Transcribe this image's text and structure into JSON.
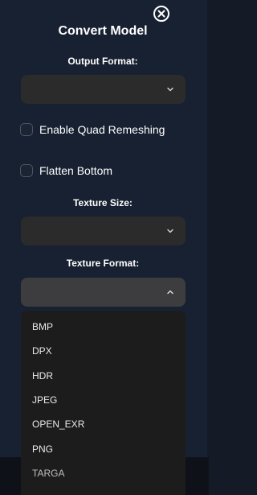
{
  "dialog": {
    "title": "Convert Model",
    "close_icon": "close-circle-icon"
  },
  "output_format": {
    "label": "Output Format:",
    "value": ""
  },
  "enable_quad_remeshing": {
    "label": "Enable Quad Remeshing",
    "checked": false
  },
  "flatten_bottom": {
    "label": "Flatten Bottom",
    "checked": false
  },
  "texture_size": {
    "label": "Texture Size:",
    "value": ""
  },
  "texture_format": {
    "label": "Texture Format:",
    "value": "",
    "expanded": true,
    "options": [
      "BMP",
      "DPX",
      "HDR",
      "JPEG",
      "OPEN_EXR",
      "PNG",
      "TARGA"
    ]
  },
  "colors": {
    "panel_bg": "#172131",
    "select_bg": "#2b2b2b",
    "dropdown_bg": "#1c1c1c",
    "text": "#ffffff"
  }
}
